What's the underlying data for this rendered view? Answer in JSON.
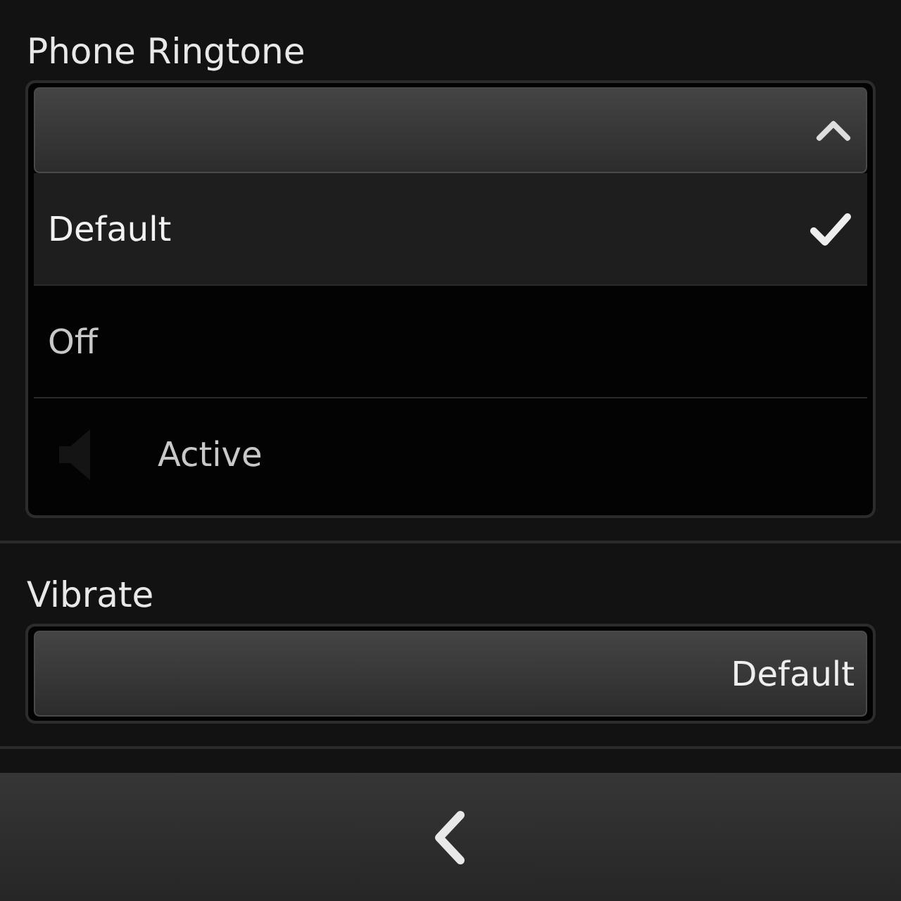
{
  "ringtone": {
    "label": "Phone Ringtone",
    "expanded": true,
    "options": [
      {
        "label": "Default",
        "selected": true,
        "kind": "plain"
      },
      {
        "label": "Off",
        "selected": false,
        "kind": "plain"
      },
      {
        "label": "Active",
        "selected": false,
        "kind": "sound"
      }
    ]
  },
  "vibrate": {
    "label": "Vibrate",
    "value": "Default"
  }
}
